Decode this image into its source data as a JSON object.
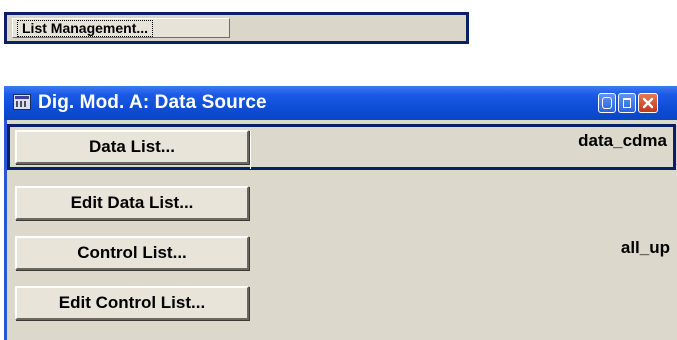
{
  "top_panel": {
    "list_management_label": "List Management..."
  },
  "dialog": {
    "title": "Dig. Mod.  A: Data Source",
    "rows": [
      {
        "button_label": "Data List...",
        "value": "data_cdma"
      },
      {
        "button_label": "Edit Data List...",
        "value": ""
      },
      {
        "button_label": "Control List...",
        "value": "all_up"
      },
      {
        "button_label": "Edit Control List...",
        "value": ""
      }
    ]
  },
  "colors": {
    "titlebar_blue": "#0e4fd8",
    "panel_gray": "#dcd8cc",
    "selection_border": "#0b1f68",
    "close_button": "#c1381a"
  },
  "icons": {
    "app": "data-table-icon",
    "minimize": "minimize-icon",
    "maximize": "maximize-icon",
    "close": "close-icon"
  }
}
